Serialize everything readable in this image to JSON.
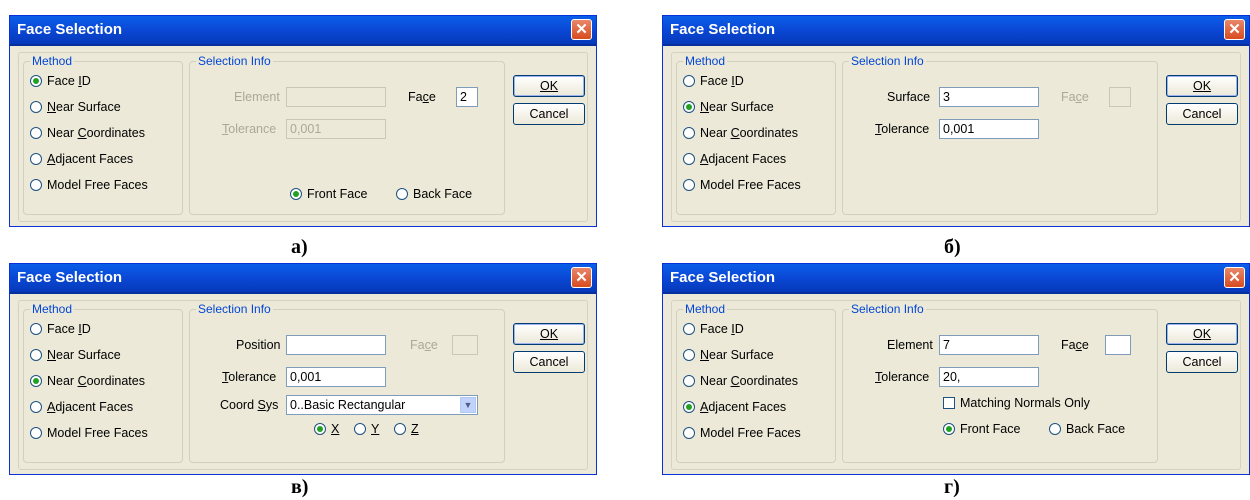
{
  "title": "Face Selection",
  "close_glyph": "✕",
  "method_legend": "Method",
  "info_legend": "Selection Info",
  "methods": [
    "Face ID",
    "Near Surface",
    "Near Coordinates",
    "Adjacent Faces",
    "Model Free Faces"
  ],
  "ok_label": "OK",
  "cancel_label": "Cancel",
  "panel_a": {
    "caption": "а)",
    "selected_method": "Face ID",
    "element_label": "Element",
    "element_value": "",
    "tolerance_label": "Tolerance",
    "tolerance_value": "0,001",
    "face_label": "Face",
    "face_value": "2",
    "front_face_label": "Front Face",
    "back_face_label": "Back Face",
    "face_side_selected": "Front Face"
  },
  "panel_b": {
    "caption": "б)",
    "selected_method": "Near Surface",
    "surface_label": "Surface",
    "surface_value": "3",
    "tolerance_label": "Tolerance",
    "tolerance_value": "0,001",
    "face_label": "Face",
    "face_value": ""
  },
  "panel_c": {
    "caption": "в)",
    "selected_method": "Near Coordinates",
    "position_label": "Position",
    "position_value": "",
    "tolerance_label": "Tolerance",
    "tolerance_value": "0,001",
    "face_label": "Face",
    "face_value": "",
    "coordsys_label": "Coord Sys",
    "coordsys_value": "0..Basic Rectangular",
    "axes": [
      "X",
      "Y",
      "Z"
    ],
    "axis_selected": "X"
  },
  "panel_d": {
    "caption": "г)",
    "selected_method": "Adjacent Faces",
    "element_label": "Element",
    "element_value": "7",
    "tolerance_label": "Tolerance",
    "tolerance_value": "20,",
    "face_label": "Face",
    "face_value": "",
    "matching_normals_label": "Matching Normals Only",
    "matching_normals_checked": false,
    "front_face_label": "Front Face",
    "back_face_label": "Back Face",
    "face_side_selected": "Front Face"
  }
}
